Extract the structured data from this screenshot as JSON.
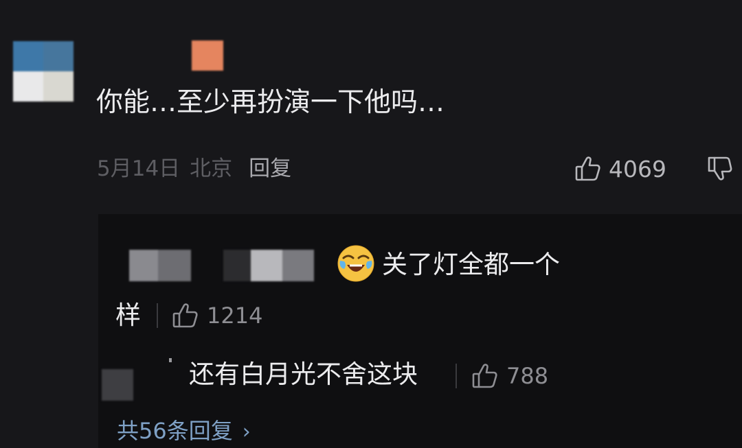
{
  "comment": {
    "text": "你能…至少再扮演一下他吗…",
    "date": "5月14日",
    "location": "北京",
    "reply_label": "回复",
    "like_count": "4069"
  },
  "replies": [
    {
      "text_line1": "关了灯全都一个",
      "text_line2": "样",
      "like_count": "1214"
    },
    {
      "text": "还有白月光不舍这块",
      "like_count": "788"
    }
  ],
  "more_replies": {
    "label": "共56条回复",
    "chevron": "›"
  },
  "colors": {
    "background": "#17171a",
    "reply_box": "#0f0f11",
    "link": "#7fa1c6",
    "badge": "#e5855f"
  },
  "icons": [
    "thumbs-up-icon",
    "thumbs-down-icon",
    "laughing-emoji-icon",
    "chevron-right-icon"
  ]
}
